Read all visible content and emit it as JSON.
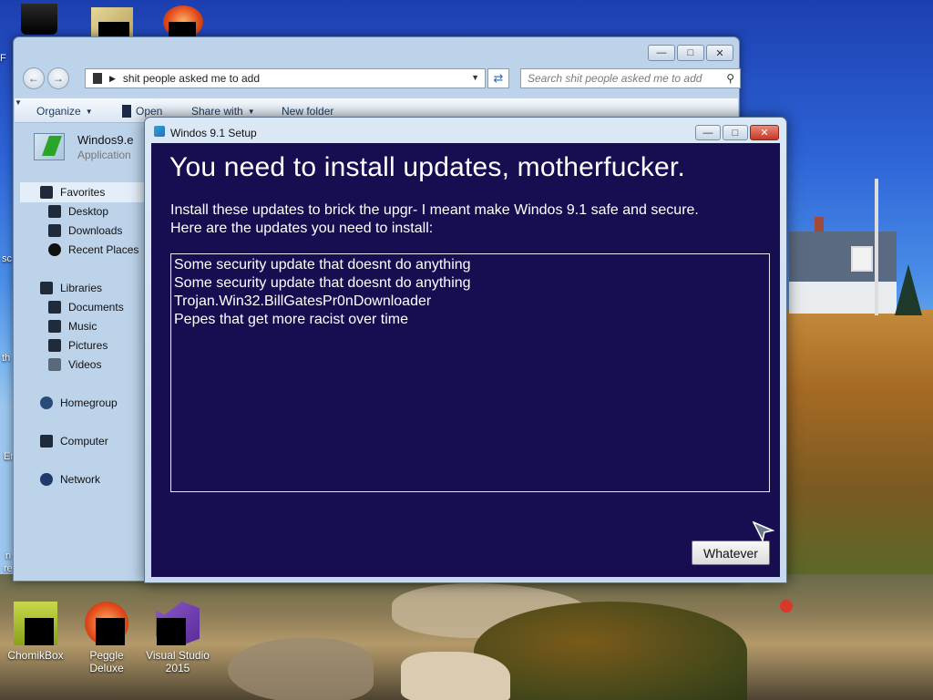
{
  "desktop": {
    "icons_bottom": [
      {
        "label": "ChomikBox"
      },
      {
        "label": "Peggle Deluxe"
      },
      {
        "label": "Visual Studio 2015"
      }
    ],
    "edge_fragments": [
      "F",
      "sc",
      "th",
      "Er",
      "n",
      "re"
    ]
  },
  "explorer": {
    "address": "shit people asked me to add",
    "search_placeholder": "Search shit people asked me to add",
    "toolbar": {
      "organize": "Organize",
      "open": "Open",
      "share_with": "Share with",
      "new_folder": "New folder"
    },
    "nav": {
      "favorites": "Favorites",
      "desktop": "Desktop",
      "downloads": "Downloads",
      "recent_places": "Recent Places",
      "libraries": "Libraries",
      "documents": "Documents",
      "music": "Music",
      "pictures": "Pictures",
      "videos": "Videos",
      "homegroup": "Homegroup",
      "computer": "Computer",
      "network": "Network"
    },
    "file": {
      "name": "Windos9.e",
      "type": "Application"
    }
  },
  "setup": {
    "title": "Windos 9.1 Setup",
    "heading": "You need to install updates, motherfucker.",
    "intro_line1": "Install these updates to brick the upgr- I meant make Windos 9.1 safe and secure.",
    "intro_line2": "Here are the updates you need to install:",
    "updates": [
      "Some security update that doesnt do anything",
      "Some security update that doesnt do anything",
      "Trojan.Win32.BillGatesPr0nDownloader",
      "Pepes that get more racist over time"
    ],
    "button_label": "Whatever"
  }
}
